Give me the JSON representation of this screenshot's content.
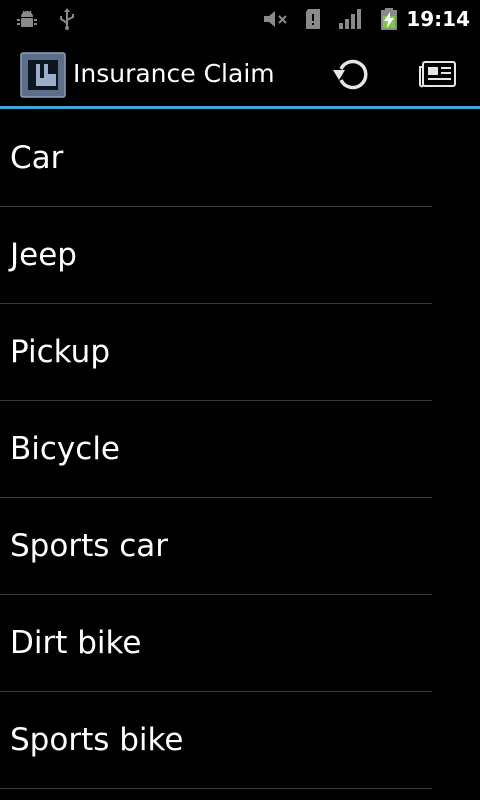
{
  "status_bar": {
    "time": "19:14",
    "icons": [
      "android-debug-icon",
      "usb-icon",
      "muted-volume-icon",
      "sd-card-icon",
      "signal-icon",
      "battery-charging-icon"
    ]
  },
  "action_bar": {
    "title": "Insurance Claim",
    "logo_icon": "app-logo-icon",
    "actions": [
      {
        "name": "refresh",
        "icon": "refresh-icon"
      },
      {
        "name": "news",
        "icon": "newspaper-icon"
      }
    ],
    "accent_color": "#3fa9d6"
  },
  "list": {
    "items": [
      {
        "label": "Car"
      },
      {
        "label": "Jeep"
      },
      {
        "label": "Pickup"
      },
      {
        "label": "Bicycle"
      },
      {
        "label": "Sports car"
      },
      {
        "label": "Dirt bike"
      },
      {
        "label": "Sports bike"
      }
    ]
  }
}
